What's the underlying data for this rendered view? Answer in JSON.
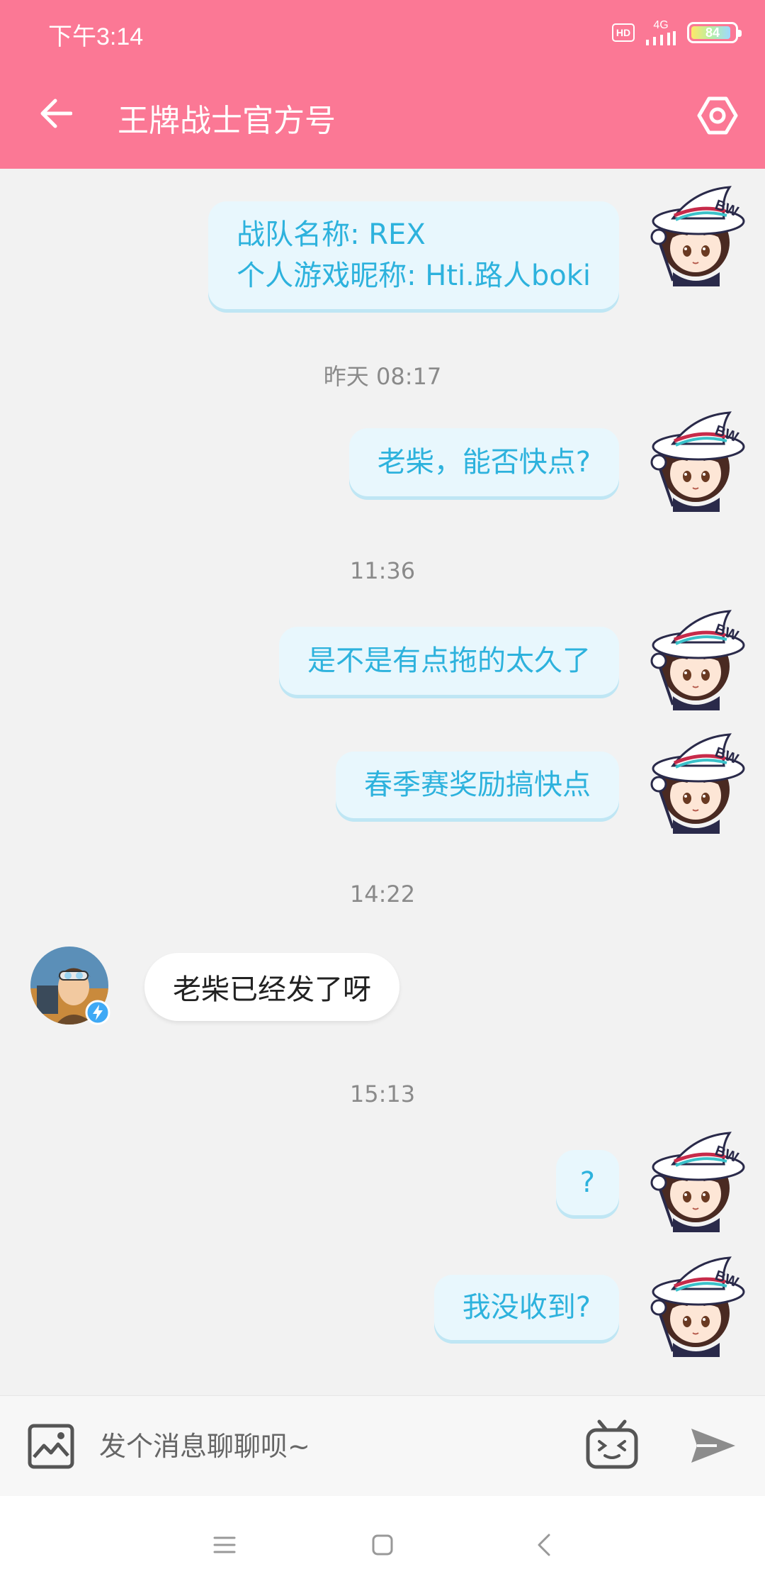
{
  "status_bar": {
    "time": "下午3:14",
    "hd_label": "HD",
    "network_label": "4G",
    "battery_level": "84"
  },
  "header": {
    "title": "王牌战士官方号"
  },
  "messages": [
    {
      "type": "out",
      "lines": [
        "战队名称: REX",
        "个人游戏昵称: Hti.路人boki"
      ]
    },
    {
      "type": "timestamp",
      "text": "昨天 08:17"
    },
    {
      "type": "out",
      "lines": [
        "老柴，能否快点?"
      ]
    },
    {
      "type": "timestamp",
      "text": "11:36"
    },
    {
      "type": "out",
      "lines": [
        "是不是有点拖的太久了"
      ]
    },
    {
      "type": "out",
      "lines": [
        "春季赛奖励搞快点"
      ]
    },
    {
      "type": "timestamp",
      "text": "14:22"
    },
    {
      "type": "in",
      "lines": [
        "老柴已经发了呀"
      ]
    },
    {
      "type": "timestamp",
      "text": "15:13"
    },
    {
      "type": "out",
      "lines": [
        "?"
      ]
    },
    {
      "type": "out",
      "lines": [
        "我没收到?"
      ]
    }
  ],
  "self_avatar_badge": "BW",
  "input": {
    "placeholder": "发个消息聊聊呗~"
  },
  "colors": {
    "header_bg": "#fb7895",
    "chat_bg": "#f2f2f2",
    "out_bubble_bg": "#e8f7fd",
    "out_bubble_text": "#2db2dd",
    "in_bubble_bg": "#ffffff"
  },
  "icons": {
    "back": "arrow-left-icon",
    "settings": "hexagon-settings-icon",
    "image": "image-icon",
    "emoji": "tv-emoji-icon",
    "send": "send-icon",
    "nav_menu": "menu-lines-icon",
    "nav_home": "square-home-icon",
    "nav_back": "chevron-left-icon"
  }
}
